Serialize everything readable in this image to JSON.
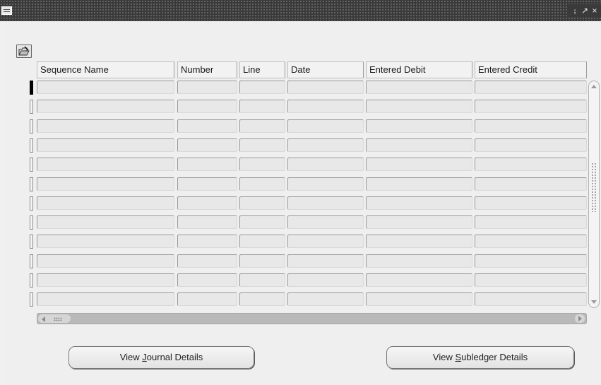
{
  "window": {
    "controls": [
      {
        "name": "minimize",
        "glyph": "⨟"
      },
      {
        "name": "maximize",
        "glyph": "↗"
      },
      {
        "name": "close",
        "glyph": "×"
      }
    ]
  },
  "toolbar": {
    "icon": "folder-edit-icon"
  },
  "table": {
    "columns": [
      {
        "label": "Sequence Name"
      },
      {
        "label": "Number"
      },
      {
        "label": "Line"
      },
      {
        "label": "Date"
      },
      {
        "label": "Entered Debit"
      },
      {
        "label": "Entered Credit"
      }
    ],
    "row_count": 12,
    "current_row": 1,
    "rows": [
      [
        "",
        "",
        "",
        "",
        "",
        ""
      ],
      [
        "",
        "",
        "",
        "",
        "",
        ""
      ],
      [
        "",
        "",
        "",
        "",
        "",
        ""
      ],
      [
        "",
        "",
        "",
        "",
        "",
        ""
      ],
      [
        "",
        "",
        "",
        "",
        "",
        ""
      ],
      [
        "",
        "",
        "",
        "",
        "",
        ""
      ],
      [
        "",
        "",
        "",
        "",
        "",
        ""
      ],
      [
        "",
        "",
        "",
        "",
        "",
        ""
      ],
      [
        "",
        "",
        "",
        "",
        "",
        ""
      ],
      [
        "",
        "",
        "",
        "",
        "",
        ""
      ],
      [
        "",
        "",
        "",
        "",
        "",
        ""
      ],
      [
        "",
        "",
        "",
        "",
        "",
        ""
      ]
    ]
  },
  "buttons": {
    "view_journal": {
      "before": "View ",
      "mnemonic": "J",
      "after": "ournal Details"
    },
    "view_subledger": {
      "before": "View ",
      "mnemonic": "S",
      "after": "ubledger Details"
    }
  }
}
